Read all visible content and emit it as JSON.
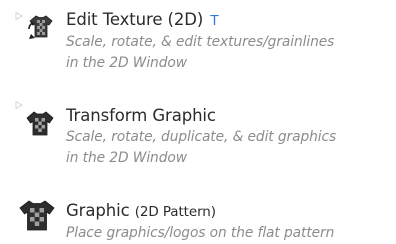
{
  "menu": {
    "items": [
      {
        "title": "Edit Texture (2D)",
        "shortcut": "T",
        "description_line1": "Scale, rotate, & edit textures/grainlines",
        "description_line2": "in the 2D Window",
        "icon": "edit-texture-icon",
        "has_flyout": true
      },
      {
        "title": "Transform Graphic",
        "shortcut": "",
        "description_line1": "Scale, rotate, duplicate, & edit graphics",
        "description_line2": "in the 2D Window",
        "icon": "transform-graphic-icon",
        "has_flyout": true
      },
      {
        "title": "Graphic",
        "title_suffix": "(2D Pattern)",
        "shortcut": "",
        "description_line1": "Place graphics/logos on the flat pattern",
        "icon": "graphic-icon",
        "has_flyout": false
      }
    ]
  },
  "colors": {
    "title": "#2b2b2b",
    "description": "#8c8c8c",
    "shortcut": "#2f7bd8"
  }
}
